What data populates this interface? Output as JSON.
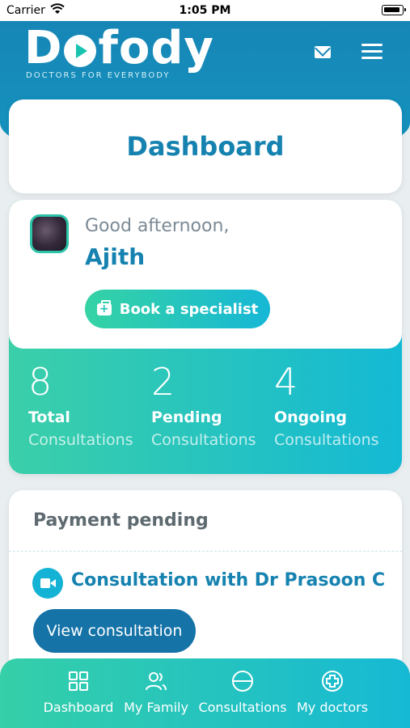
{
  "status_bar": {
    "carrier": "Carrier",
    "time": "1:05 PM"
  },
  "header": {
    "logo_prefix": "D",
    "logo_suffix": "fody",
    "tagline": "DOCTORS FOR EVERYBODY",
    "icons": [
      "mail-icon",
      "menu-icon"
    ]
  },
  "dashboard": {
    "title": "Dashboard"
  },
  "greeting": {
    "salutation": "Good afternoon,",
    "name": "Ajith",
    "book_button": "Book a specialist"
  },
  "stats": [
    {
      "value": "8",
      "label": "Total",
      "sub": "Consultations"
    },
    {
      "value": "2",
      "label": "Pending",
      "sub": "Consultations"
    },
    {
      "value": "4",
      "label": "Ongoing",
      "sub": "Consultations"
    }
  ],
  "payment": {
    "heading": "Payment pending",
    "consultation_title": "Consultation with Dr Prasoon C",
    "view_button": "View consultation"
  },
  "tabs": [
    {
      "label": "Dashboard",
      "icon": "grid-icon"
    },
    {
      "label": "My Family",
      "icon": "users-icon"
    },
    {
      "label": "Consultations",
      "icon": "minus-circle-icon"
    },
    {
      "label": "My doctors",
      "icon": "plus-circle-icon"
    }
  ],
  "colors": {
    "primary": "#1582b0",
    "header": "#1686b6",
    "gradient_start": "#35cfa8",
    "gradient_end": "#16b9d4",
    "button_dark": "#1573a8"
  }
}
